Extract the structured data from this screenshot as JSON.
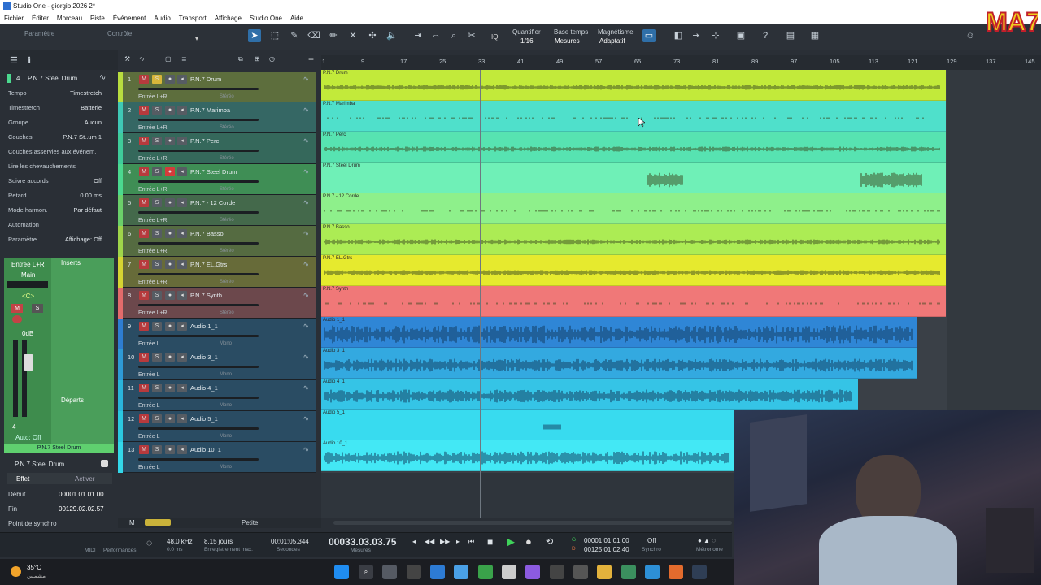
{
  "window": {
    "title": "Studio One - giorgio 2026 2*"
  },
  "menu": [
    "Fichier",
    "Éditer",
    "Morceau",
    "Piste",
    "Événement",
    "Audio",
    "Transport",
    "Affichage",
    "Studio One",
    "Aide"
  ],
  "toolbar": {
    "param_label": "Paramètre",
    "control_label": "Contrôle",
    "quantize_label": "Quantifier",
    "quantize_value": "1/16",
    "timebase_label": "Base temps",
    "timebase_value": "Mesures",
    "snap_label": "Magnétisme",
    "snap_value": "Adaptatif",
    "iq": "IQ"
  },
  "ruler": {
    "ticks": [
      "1",
      "9",
      "17",
      "25",
      "33",
      "41",
      "49",
      "57",
      "65",
      "73",
      "81",
      "89",
      "97",
      "105",
      "113",
      "121",
      "129",
      "137",
      "145"
    ]
  },
  "inspector": {
    "track_number": "4",
    "track_name": "P.N.7 Steel Drum",
    "rows": [
      {
        "label": "Tempo",
        "value": "Timestretch"
      },
      {
        "label": "Timestretch",
        "value": "Batterie"
      },
      {
        "label": "Groupe",
        "value": "Aucun"
      },
      {
        "label": "Couches",
        "value": "P.N.7 St..um 1"
      },
      {
        "label": "Couches asservies aux événem.",
        "value": ""
      },
      {
        "label": "Lire les chevauchements",
        "value": ""
      },
      {
        "label": "Suivre accords",
        "value": "Off"
      },
      {
        "label": "Retard",
        "value": "0.00 ms"
      },
      {
        "label": "Mode harmon.",
        "value": "Par défaut"
      },
      {
        "label": "Automation",
        "value": ""
      },
      {
        "label": "Paramètre",
        "value": "Affichage: Off"
      }
    ],
    "channel": {
      "input": "Entrée L+R",
      "output": "Main",
      "pan": "<C>",
      "volume": "0dB",
      "inserts": "Inserts",
      "sends": "Départs",
      "name": "P.N.7 Steel Drum",
      "auto": "Auto: Off",
      "number": "4"
    },
    "event": {
      "name": "P.N.7 Steel Drum",
      "effect_tab": "Effet",
      "activate_tab": "Activer",
      "start_label": "Début",
      "start_value": "00001.01.01.00",
      "end_label": "Fin",
      "end_value": "00129.02.02.57",
      "snap_label": "Point de synchro"
    }
  },
  "tracks": [
    {
      "n": "1",
      "name": "P.N.7 Drum",
      "input": "Entrée L+R",
      "mode": "Stéréo",
      "color": "#b8dd3f",
      "clip": "#c2ea3a",
      "clip_name": "P.N.7 Drum",
      "solo": true,
      "rec": false
    },
    {
      "n": "2",
      "name": "P.N.7 Marimba",
      "input": "Entrée L+R",
      "mode": "Stéréo",
      "color": "#3fc8b5",
      "clip": "#4fe0cb",
      "clip_name": "P.N.7 Marimba",
      "solo": false,
      "rec": false
    },
    {
      "n": "3",
      "name": "P.N.7 Perc",
      "input": "Entrée L+R",
      "mode": "Stéréo",
      "color": "#3fcc9a",
      "clip": "#57e3b1",
      "clip_name": "P.N.7 Perc",
      "solo": false,
      "rec": false
    },
    {
      "n": "4",
      "name": "P.N.7 Steel Drum",
      "input": "Entrée L+R",
      "mode": "Stéréo",
      "color": "#4bd98f",
      "clip": "#6ff0b7",
      "clip_name": "P.N.7 Steel Drum",
      "solo": false,
      "rec": true
    },
    {
      "n": "5",
      "name": "P.N.7 - 12 Corde",
      "input": "Entrée L+R",
      "mode": "Stéréo",
      "color": "#6bd06a",
      "clip": "#8ef08b",
      "clip_name": "P.N.7 - 12 Corde",
      "solo": false,
      "rec": false
    },
    {
      "n": "6",
      "name": "P.N.7 Basso",
      "input": "Entrée L+R",
      "mode": "Stéréo",
      "color": "#9fd54a",
      "clip": "#acec54",
      "clip_name": "P.N.7 Basso",
      "solo": false,
      "rec": false
    },
    {
      "n": "7",
      "name": "P.N.7 EL.Gtrs",
      "input": "Entrée L+R",
      "mode": "Stéréo",
      "color": "#d6d432",
      "clip": "#e6ea2e",
      "clip_name": "P.N.7 EL.Gtrs",
      "solo": false,
      "rec": false
    },
    {
      "n": "8",
      "name": "P.N.7 Synth",
      "input": "Entrée L+R",
      "mode": "Stéréo",
      "color": "#e36b6b",
      "clip": "#f07878",
      "clip_name": "P.N.7 Synth",
      "solo": false,
      "rec": false
    },
    {
      "n": "9",
      "name": "Audio 1_1",
      "input": "Entrée L",
      "mode": "Mono",
      "color": "#2e7dd1",
      "clip": "#2f86d6",
      "clip_name": "Audio 1_1",
      "solo": false,
      "rec": false
    },
    {
      "n": "10",
      "name": "Audio 3_1",
      "input": "Entrée L",
      "mode": "Mono",
      "color": "#2e9ad6",
      "clip": "#33a9e0",
      "clip_name": "Audio 3_1",
      "solo": false,
      "rec": false
    },
    {
      "n": "11",
      "name": "Audio 4_1",
      "input": "Entrée L",
      "mode": "Mono",
      "color": "#2ab4db",
      "clip": "#35c4e6",
      "clip_name": "Audio 4_1",
      "solo": false,
      "rec": false
    },
    {
      "n": "12",
      "name": "Audio 5_1",
      "input": "Entrée L",
      "mode": "Mono",
      "color": "#2bc8e0",
      "clip": "#38dbef",
      "clip_name": "Audio 5_1",
      "solo": false,
      "rec": false
    },
    {
      "n": "13",
      "name": "Audio 10_1",
      "input": "Entrée L",
      "mode": "Mono",
      "color": "#33d8ea",
      "clip": "#43e8f5",
      "clip_name": "Audio 10_1",
      "solo": false,
      "rec": false
    }
  ],
  "clip_ends": [
    1163,
    1163,
    1163,
    1163,
    1163,
    1163,
    1163,
    1163,
    1128,
    1128,
    1055,
    902,
    902
  ],
  "track_size_label": "Petite",
  "m_label": "M",
  "transport": {
    "midi": "MIDI",
    "performance": "Performances",
    "samplerate": "48.0 kHz",
    "latency": "0.0 ms",
    "recmax": "8.15 jours",
    "recmax_label": "Enregistrement max.",
    "seconds": "00:01:05.344",
    "seconds_label": "Secondes",
    "position": "00033.03.03.75",
    "position_label": "Mesures",
    "loop_start": "00001.01.01.00",
    "loop_end": "00125.01.02.40",
    "sync": "Off",
    "sync_label": "Synchro",
    "metronome_label": "Métronome"
  },
  "taskbar": {
    "temp": "35°C",
    "weather": "مشمس"
  },
  "logo": "MA7"
}
